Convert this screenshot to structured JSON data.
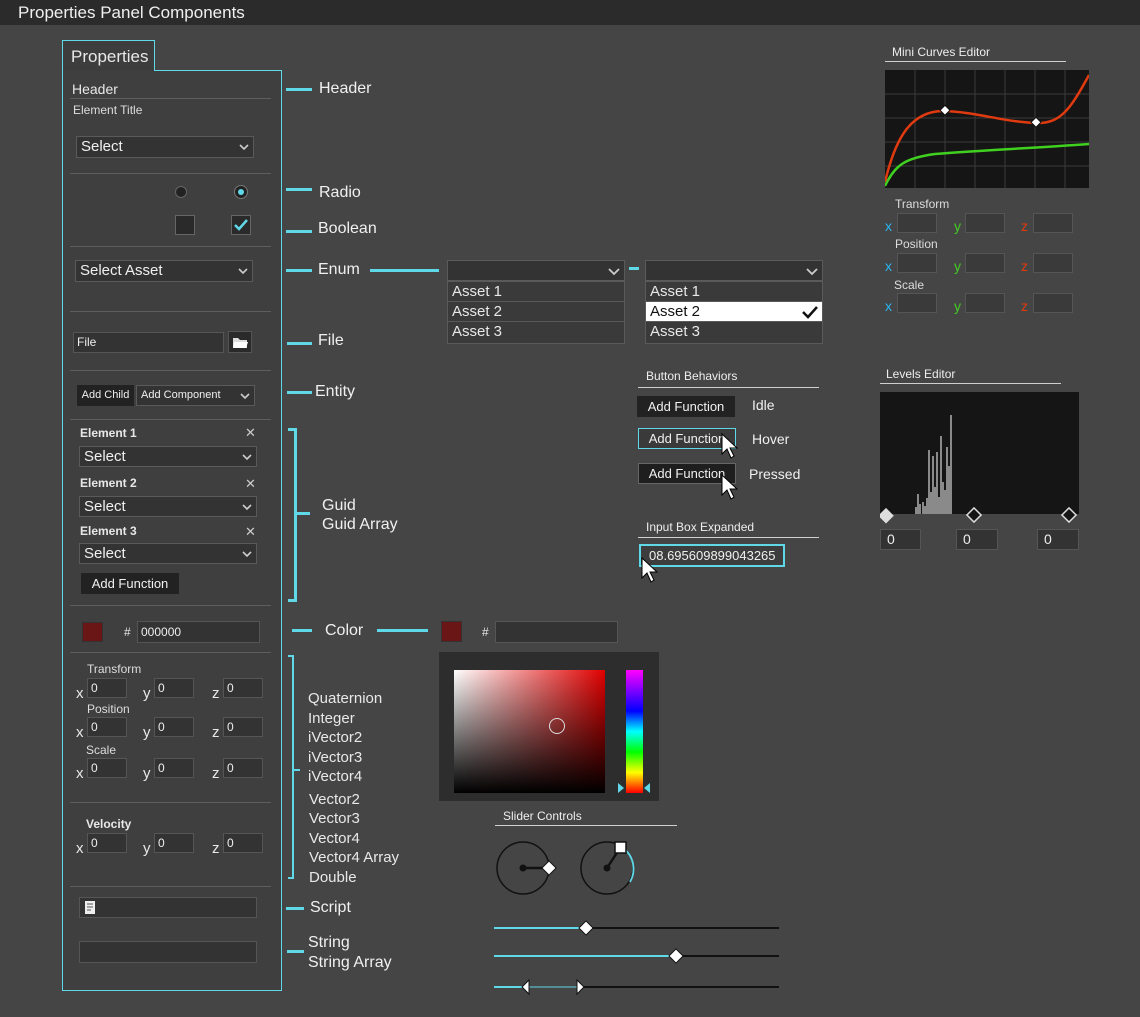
{
  "window": {
    "title": "Properties Panel Components"
  },
  "panel": {
    "tab_label": "Properties",
    "header_label": "Header",
    "element_title": "Element Title",
    "select_value": "Select",
    "enum_value": "Select Asset",
    "file_value": "File",
    "add_child": "Add Child",
    "add_component": "Add Component",
    "elements": [
      {
        "label": "Element 1",
        "value": "Select"
      },
      {
        "label": "Element 2",
        "value": "Select"
      },
      {
        "label": "Element 3",
        "value": "Select"
      }
    ],
    "add_function": "Add Function",
    "color_hash": "#",
    "color_value": "000000",
    "vectors": {
      "transform": "Transform",
      "position": "Position",
      "scale": "Scale",
      "velocity": "Velocity",
      "x": "x",
      "y": "y",
      "z": "z",
      "zero": "0"
    }
  },
  "callouts": {
    "header": "Header",
    "radio": "Radio",
    "boolean": "Boolean",
    "enum": "Enum",
    "file": "File",
    "entity": "Entity",
    "guid": "Guid",
    "guid_array": "Guid Array",
    "color": "Color",
    "types": [
      "Quaternion",
      "Integer",
      "iVector2",
      "iVector3",
      "iVector4",
      "Vector2",
      "Vector3",
      "Vector4",
      "Vector4 Array",
      "Double"
    ],
    "script": "Script",
    "string": "String",
    "string_array": "String Array"
  },
  "enum_lists": {
    "options": [
      "Asset 1",
      "Asset 2",
      "Asset 3"
    ],
    "selected": "Asset 2"
  },
  "button_behaviors": {
    "title": "Button Behaviors",
    "button_label": "Add Function",
    "states": [
      "Idle",
      "Hover",
      "Pressed"
    ]
  },
  "input_box": {
    "title": "Input Box Expanded",
    "value": "08.695609899043265"
  },
  "color_picker": {
    "hash": "#",
    "swatch": "#6b1616"
  },
  "slider_controls": {
    "title": "Slider Controls"
  },
  "mini_curves": {
    "title": "Mini Curves Editor",
    "transform": "Transform",
    "position": "Position",
    "scale": "Scale",
    "x": "x",
    "y": "y",
    "z": "z"
  },
  "levels_editor": {
    "title": "Levels Editor",
    "values": [
      "0",
      "0",
      "0"
    ]
  },
  "colors": {
    "accent": "#5fd8e8",
    "curve_red": "#e03a10",
    "curve_green": "#3fd020",
    "swatch": "#6b1616"
  }
}
